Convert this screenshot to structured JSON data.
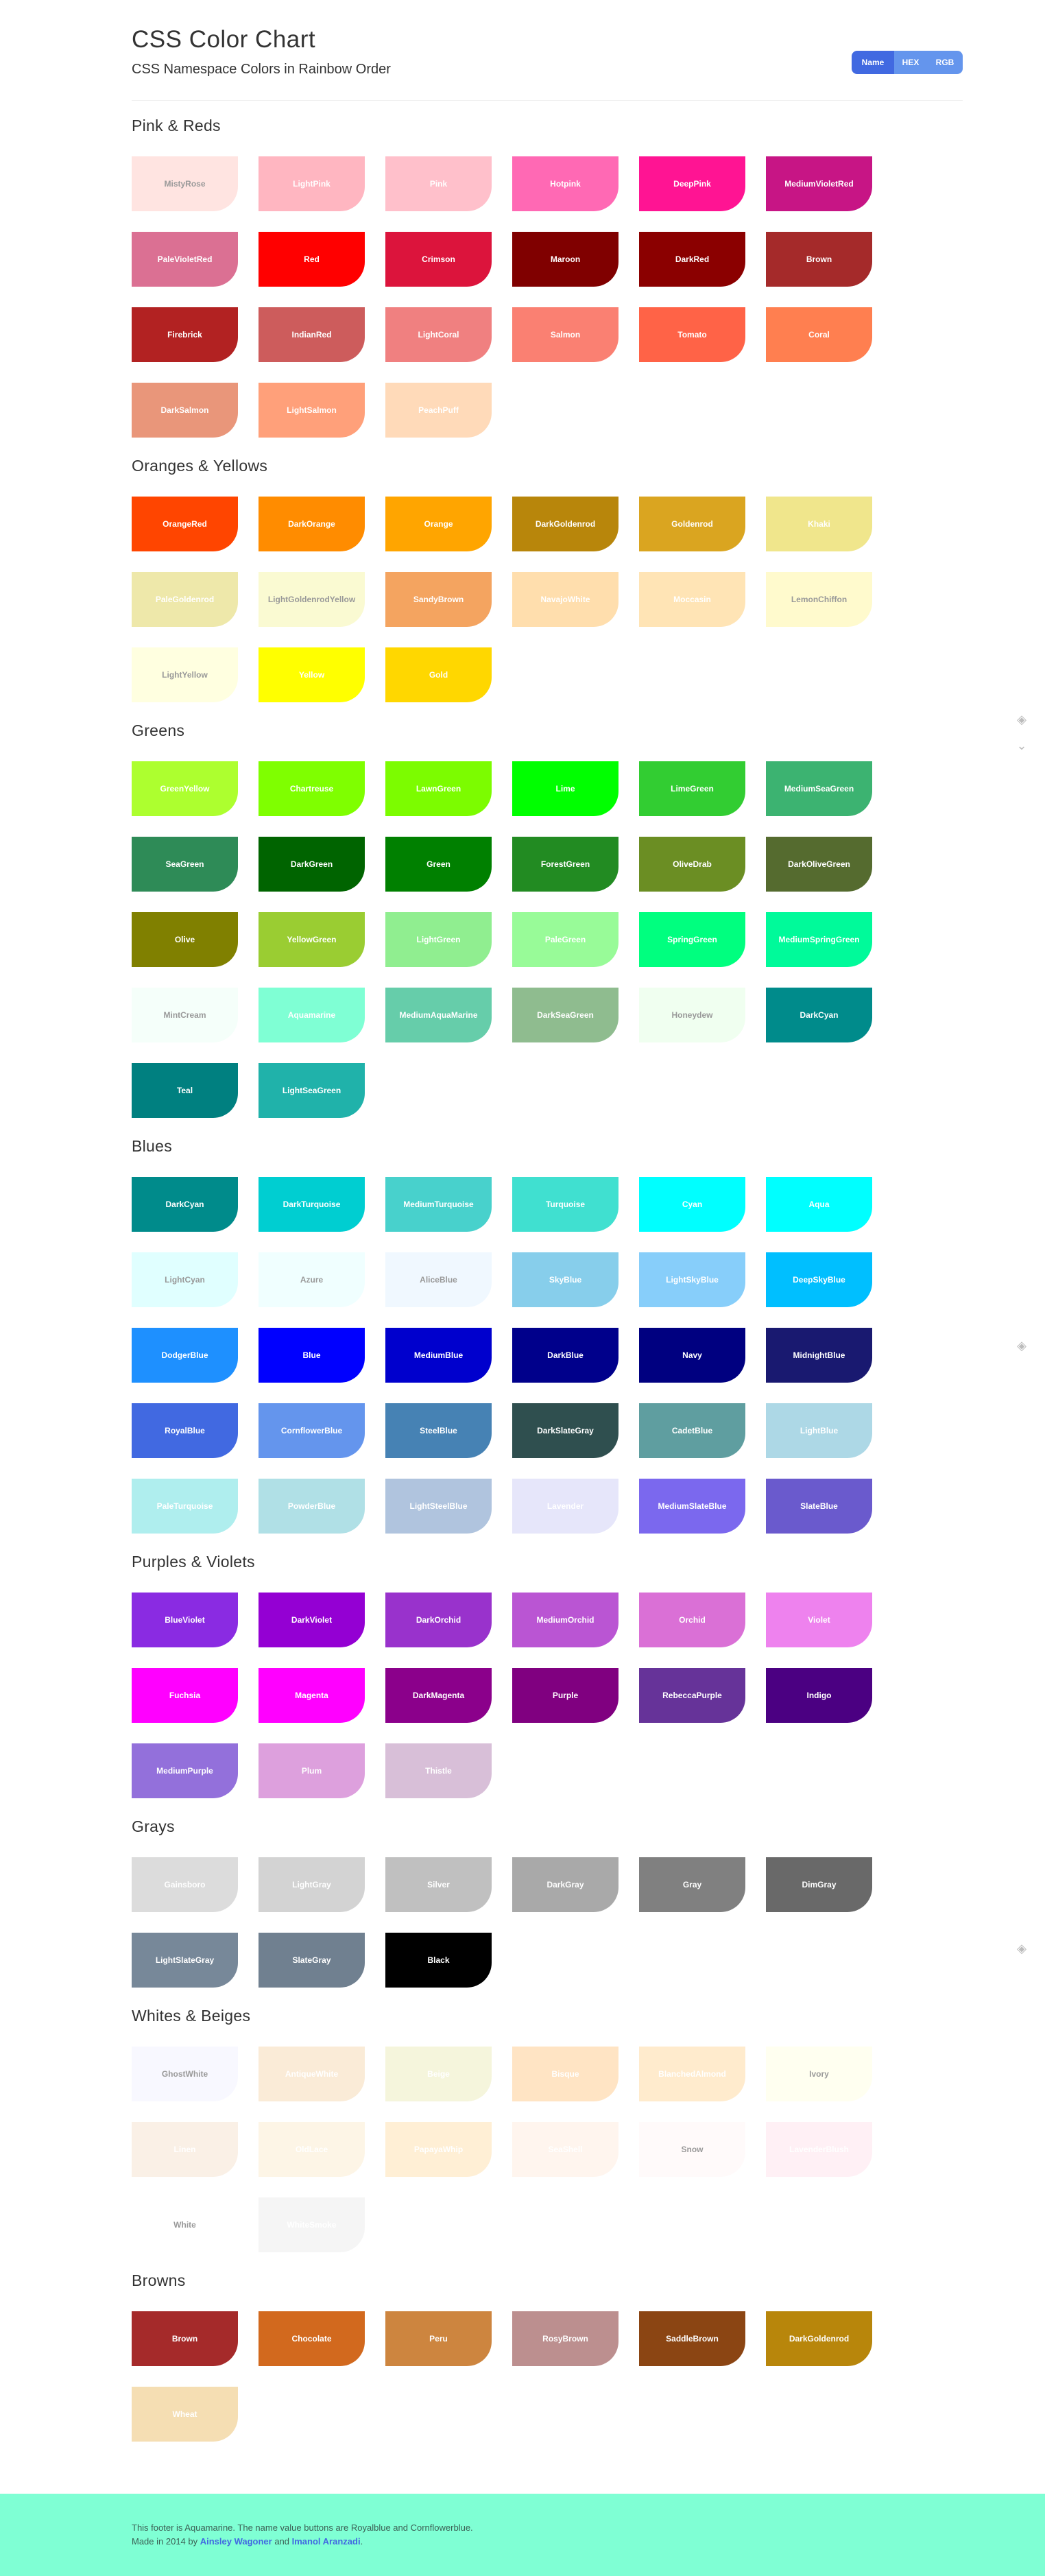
{
  "header": {
    "title": "CSS Color Chart",
    "subtitle": "CSS Namespace Colors in Rainbow Order",
    "buttons": {
      "name": "Name",
      "hex": "HEX",
      "rgb": "RGB"
    }
  },
  "sections": [
    {
      "title": "Pink & Reds",
      "colors": [
        {
          "name": "MistyRose",
          "hex": "#FFE4E1",
          "text": "#999999"
        },
        {
          "name": "LightPink",
          "hex": "#FFB6C1",
          "text": "#ffffff"
        },
        {
          "name": "Pink",
          "hex": "#FFC0CB",
          "text": "#ffffff"
        },
        {
          "name": "Hotpink",
          "hex": "#FF69B4",
          "text": "#ffffff"
        },
        {
          "name": "DeepPink",
          "hex": "#FF1493",
          "text": "#ffffff"
        },
        {
          "name": "MediumVioletRed",
          "hex": "#C71585",
          "text": "#ffffff"
        },
        {
          "name": "PaleVioletRed",
          "hex": "#DB7093",
          "text": "#ffffff"
        },
        {
          "name": "Red",
          "hex": "#FF0000",
          "text": "#ffffff"
        },
        {
          "name": "Crimson",
          "hex": "#DC143C",
          "text": "#ffffff"
        },
        {
          "name": "Maroon",
          "hex": "#800000",
          "text": "#ffffff"
        },
        {
          "name": "DarkRed",
          "hex": "#8B0000",
          "text": "#ffffff"
        },
        {
          "name": "Brown",
          "hex": "#A52A2A",
          "text": "#ffffff"
        },
        {
          "name": "Firebrick",
          "hex": "#B22222",
          "text": "#ffffff"
        },
        {
          "name": "IndianRed",
          "hex": "#CD5C5C",
          "text": "#ffffff"
        },
        {
          "name": "LightCoral",
          "hex": "#F08080",
          "text": "#ffffff"
        },
        {
          "name": "Salmon",
          "hex": "#FA8072",
          "text": "#ffffff"
        },
        {
          "name": "Tomato",
          "hex": "#FF6347",
          "text": "#ffffff"
        },
        {
          "name": "Coral",
          "hex": "#FF7F50",
          "text": "#ffffff"
        },
        {
          "name": "DarkSalmon",
          "hex": "#E9967A",
          "text": "#ffffff"
        },
        {
          "name": "LightSalmon",
          "hex": "#FFA07A",
          "text": "#ffffff"
        },
        {
          "name": "PeachPuff",
          "hex": "#FFDAB9",
          "text": "#ffffff"
        }
      ]
    },
    {
      "title": "Oranges & Yellows",
      "colors": [
        {
          "name": "OrangeRed",
          "hex": "#FF4500",
          "text": "#ffffff"
        },
        {
          "name": "DarkOrange",
          "hex": "#FF8C00",
          "text": "#ffffff"
        },
        {
          "name": "Orange",
          "hex": "#FFA500",
          "text": "#ffffff"
        },
        {
          "name": "DarkGoldenrod",
          "hex": "#B8860B",
          "text": "#ffffff"
        },
        {
          "name": "Goldenrod",
          "hex": "#DAA520",
          "text": "#ffffff"
        },
        {
          "name": "Khaki",
          "hex": "#F0E68C",
          "text": "#ffffff"
        },
        {
          "name": "PaleGoldenrod",
          "hex": "#EEE8AA",
          "text": "#ffffff"
        },
        {
          "name": "LightGoldenrodYellow",
          "hex": "#FAFAD2",
          "text": "#999999"
        },
        {
          "name": "SandyBrown",
          "hex": "#F4A460",
          "text": "#ffffff"
        },
        {
          "name": "NavajoWhite",
          "hex": "#FFDEAD",
          "text": "#ffffff"
        },
        {
          "name": "Moccasin",
          "hex": "#FFE4B5",
          "text": "#ffffff"
        },
        {
          "name": "LemonChiffon",
          "hex": "#FFFACD",
          "text": "#999999"
        },
        {
          "name": "LightYellow",
          "hex": "#FFFFE0",
          "text": "#999999"
        },
        {
          "name": "Yellow",
          "hex": "#FFFF00",
          "text": "#ffffff"
        },
        {
          "name": "Gold",
          "hex": "#FFD700",
          "text": "#ffffff"
        }
      ]
    },
    {
      "title": "Greens",
      "colors": [
        {
          "name": "GreenYellow",
          "hex": "#ADFF2F",
          "text": "#ffffff"
        },
        {
          "name": "Chartreuse",
          "hex": "#7FFF00",
          "text": "#ffffff"
        },
        {
          "name": "LawnGreen",
          "hex": "#7CFC00",
          "text": "#ffffff"
        },
        {
          "name": "Lime",
          "hex": "#00FF00",
          "text": "#ffffff"
        },
        {
          "name": "LimeGreen",
          "hex": "#32CD32",
          "text": "#ffffff"
        },
        {
          "name": "MediumSeaGreen",
          "hex": "#3CB371",
          "text": "#ffffff"
        },
        {
          "name": "SeaGreen",
          "hex": "#2E8B57",
          "text": "#ffffff"
        },
        {
          "name": "DarkGreen",
          "hex": "#006400",
          "text": "#ffffff"
        },
        {
          "name": "Green",
          "hex": "#008000",
          "text": "#ffffff"
        },
        {
          "name": "ForestGreen",
          "hex": "#228B22",
          "text": "#ffffff"
        },
        {
          "name": "OliveDrab",
          "hex": "#6B8E23",
          "text": "#ffffff"
        },
        {
          "name": "DarkOliveGreen",
          "hex": "#556B2F",
          "text": "#ffffff"
        },
        {
          "name": "Olive",
          "hex": "#808000",
          "text": "#ffffff"
        },
        {
          "name": "YellowGreen",
          "hex": "#9ACD32",
          "text": "#ffffff"
        },
        {
          "name": "LightGreen",
          "hex": "#90EE90",
          "text": "#ffffff"
        },
        {
          "name": "PaleGreen",
          "hex": "#98FB98",
          "text": "#ffffff"
        },
        {
          "name": "SpringGreen",
          "hex": "#00FF7F",
          "text": "#ffffff"
        },
        {
          "name": "MediumSpringGreen",
          "hex": "#00FA9A",
          "text": "#ffffff"
        },
        {
          "name": "MintCream",
          "hex": "#F5FFFA",
          "text": "#999999"
        },
        {
          "name": "Aquamarine",
          "hex": "#7FFFD4",
          "text": "#ffffff"
        },
        {
          "name": "MediumAquaMarine",
          "hex": "#66CDAA",
          "text": "#ffffff"
        },
        {
          "name": "DarkSeaGreen",
          "hex": "#8FBC8F",
          "text": "#ffffff"
        },
        {
          "name": "Honeydew",
          "hex": "#F0FFF0",
          "text": "#999999"
        },
        {
          "name": "DarkCyan",
          "hex": "#008B8B",
          "text": "#ffffff"
        },
        {
          "name": "Teal",
          "hex": "#008080",
          "text": "#ffffff"
        },
        {
          "name": "LightSeaGreen",
          "hex": "#20B2AA",
          "text": "#ffffff"
        }
      ]
    },
    {
      "title": "Blues",
      "colors": [
        {
          "name": "DarkCyan",
          "hex": "#008B8B",
          "text": "#ffffff"
        },
        {
          "name": "DarkTurquoise",
          "hex": "#00CED1",
          "text": "#ffffff"
        },
        {
          "name": "MediumTurquoise",
          "hex": "#48D1CC",
          "text": "#ffffff"
        },
        {
          "name": "Turquoise",
          "hex": "#40E0D0",
          "text": "#ffffff"
        },
        {
          "name": "Cyan",
          "hex": "#00FFFF",
          "text": "#ffffff"
        },
        {
          "name": "Aqua",
          "hex": "#00FFFF",
          "text": "#ffffff"
        },
        {
          "name": "LightCyan",
          "hex": "#E0FFFF",
          "text": "#999999"
        },
        {
          "name": "Azure",
          "hex": "#F0FFFF",
          "text": "#999999"
        },
        {
          "name": "AliceBlue",
          "hex": "#F0F8FF",
          "text": "#999999"
        },
        {
          "name": "SkyBlue",
          "hex": "#87CEEB",
          "text": "#ffffff"
        },
        {
          "name": "LightSkyBlue",
          "hex": "#87CEFA",
          "text": "#ffffff"
        },
        {
          "name": "DeepSkyBlue",
          "hex": "#00BFFF",
          "text": "#ffffff"
        },
        {
          "name": "DodgerBlue",
          "hex": "#1E90FF",
          "text": "#ffffff"
        },
        {
          "name": "Blue",
          "hex": "#0000FF",
          "text": "#ffffff"
        },
        {
          "name": "MediumBlue",
          "hex": "#0000CD",
          "text": "#ffffff"
        },
        {
          "name": "DarkBlue",
          "hex": "#00008B",
          "text": "#ffffff"
        },
        {
          "name": "Navy",
          "hex": "#000080",
          "text": "#ffffff"
        },
        {
          "name": "MidnightBlue",
          "hex": "#191970",
          "text": "#ffffff"
        },
        {
          "name": "RoyalBlue",
          "hex": "#4169E1",
          "text": "#ffffff"
        },
        {
          "name": "CornflowerBlue",
          "hex": "#6495ED",
          "text": "#ffffff"
        },
        {
          "name": "SteelBlue",
          "hex": "#4682B4",
          "text": "#ffffff"
        },
        {
          "name": "DarkSlateGray",
          "hex": "#2F4F4F",
          "text": "#ffffff"
        },
        {
          "name": "CadetBlue",
          "hex": "#5F9EA0",
          "text": "#ffffff"
        },
        {
          "name": "LightBlue",
          "hex": "#ADD8E6",
          "text": "#ffffff"
        },
        {
          "name": "PaleTurquoise",
          "hex": "#AFEEEE",
          "text": "#ffffff"
        },
        {
          "name": "PowderBlue",
          "hex": "#B0E0E6",
          "text": "#ffffff"
        },
        {
          "name": "LightSteelBlue",
          "hex": "#B0C4DE",
          "text": "#ffffff"
        },
        {
          "name": "Lavender",
          "hex": "#E6E6FA",
          "text": "#ffffff"
        },
        {
          "name": "MediumSlateBlue",
          "hex": "#7B68EE",
          "text": "#ffffff"
        },
        {
          "name": "SlateBlue",
          "hex": "#6A5ACD",
          "text": "#ffffff"
        }
      ]
    },
    {
      "title": "Purples & Violets",
      "colors": [
        {
          "name": "BlueViolet",
          "hex": "#8A2BE2",
          "text": "#ffffff"
        },
        {
          "name": "DarkViolet",
          "hex": "#9400D3",
          "text": "#ffffff"
        },
        {
          "name": "DarkOrchid",
          "hex": "#9932CC",
          "text": "#ffffff"
        },
        {
          "name": "MediumOrchid",
          "hex": "#BA55D3",
          "text": "#ffffff"
        },
        {
          "name": "Orchid",
          "hex": "#DA70D6",
          "text": "#ffffff"
        },
        {
          "name": "Violet",
          "hex": "#EE82EE",
          "text": "#ffffff"
        },
        {
          "name": "Fuchsia",
          "hex": "#FF00FF",
          "text": "#ffffff"
        },
        {
          "name": "Magenta",
          "hex": "#FF00FF",
          "text": "#ffffff"
        },
        {
          "name": "DarkMagenta",
          "hex": "#8B008B",
          "text": "#ffffff"
        },
        {
          "name": "Purple",
          "hex": "#800080",
          "text": "#ffffff"
        },
        {
          "name": "RebeccaPurple",
          "hex": "#663399",
          "text": "#ffffff"
        },
        {
          "name": "Indigo",
          "hex": "#4B0082",
          "text": "#ffffff"
        },
        {
          "name": "MediumPurple",
          "hex": "#9370DB",
          "text": "#ffffff"
        },
        {
          "name": "Plum",
          "hex": "#DDA0DD",
          "text": "#ffffff"
        },
        {
          "name": "Thistle",
          "hex": "#D8BFD8",
          "text": "#ffffff"
        }
      ]
    },
    {
      "title": "Grays",
      "colors": [
        {
          "name": "Gainsboro",
          "hex": "#DCDCDC",
          "text": "#ffffff"
        },
        {
          "name": "LightGray",
          "hex": "#D3D3D3",
          "text": "#ffffff"
        },
        {
          "name": "Silver",
          "hex": "#C0C0C0",
          "text": "#ffffff"
        },
        {
          "name": "DarkGray",
          "hex": "#A9A9A9",
          "text": "#ffffff"
        },
        {
          "name": "Gray",
          "hex": "#808080",
          "text": "#ffffff"
        },
        {
          "name": "DimGray",
          "hex": "#696969",
          "text": "#ffffff"
        },
        {
          "name": "LightSlateGray",
          "hex": "#778899",
          "text": "#ffffff"
        },
        {
          "name": "SlateGray",
          "hex": "#708090",
          "text": "#ffffff"
        },
        {
          "name": "Black",
          "hex": "#000000",
          "text": "#ffffff"
        }
      ]
    },
    {
      "title": "Whites & Beiges",
      "colors": [
        {
          "name": "GhostWhite",
          "hex": "#F8F8FF",
          "text": "#999999"
        },
        {
          "name": "AntiqueWhite",
          "hex": "#FAEBD7",
          "text": "#ffffff"
        },
        {
          "name": "Beige",
          "hex": "#F5F5DC",
          "text": "#ffffff"
        },
        {
          "name": "Bisque",
          "hex": "#FFE4C4",
          "text": "#ffffff"
        },
        {
          "name": "BlanchedAlmond",
          "hex": "#FFEBCD",
          "text": "#ffffff"
        },
        {
          "name": "Ivory",
          "hex": "#FFFFF0",
          "text": "#999999"
        },
        {
          "name": "Linen",
          "hex": "#FAF0E6",
          "text": "#ffffff"
        },
        {
          "name": "OldLace",
          "hex": "#FDF5E6",
          "text": "#ffffff"
        },
        {
          "name": "PapayaWhip",
          "hex": "#FFEFD5",
          "text": "#ffffff"
        },
        {
          "name": "SeaShell",
          "hex": "#FFF5EE",
          "text": "#ffffff"
        },
        {
          "name": "Snow",
          "hex": "#FFFAFA",
          "text": "#999999"
        },
        {
          "name": "LavenderBlush",
          "hex": "#FFF0F5",
          "text": "#ffffff"
        },
        {
          "name": "White",
          "hex": "#FFFFFF",
          "text": "#999999"
        },
        {
          "name": "WhiteSmoke",
          "hex": "#F5F5F5",
          "text": "#ffffff"
        }
      ]
    },
    {
      "title": "Browns",
      "colors": [
        {
          "name": "Brown",
          "hex": "#A52A2A",
          "text": "#ffffff"
        },
        {
          "name": "Chocolate",
          "hex": "#D2691E",
          "text": "#ffffff"
        },
        {
          "name": "Peru",
          "hex": "#CD853F",
          "text": "#ffffff"
        },
        {
          "name": "RosyBrown",
          "hex": "#BC8F8F",
          "text": "#ffffff"
        },
        {
          "name": "SaddleBrown",
          "hex": "#8B4513",
          "text": "#ffffff"
        },
        {
          "name": "DarkGoldenrod",
          "hex": "#B8860B",
          "text": "#ffffff"
        },
        {
          "name": "Wheat",
          "hex": "#F5DEB3",
          "text": "#ffffff"
        }
      ]
    }
  ],
  "footer": {
    "line1": "This footer is Aquamarine. The name value buttons are Royalblue and Cornflowerblue.",
    "made_prefix": "Made in 2014 by ",
    "author1": "Ainsley Wagoner",
    "and": " and ",
    "author2": "Imanol Aranzadi",
    "period": "."
  },
  "side_icons": [
    "diamond-arrow-icon",
    "chevron-down-icon",
    "diamond-arrow-icon",
    "diamond-arrow-icon",
    "diamond-arrow-icon"
  ]
}
